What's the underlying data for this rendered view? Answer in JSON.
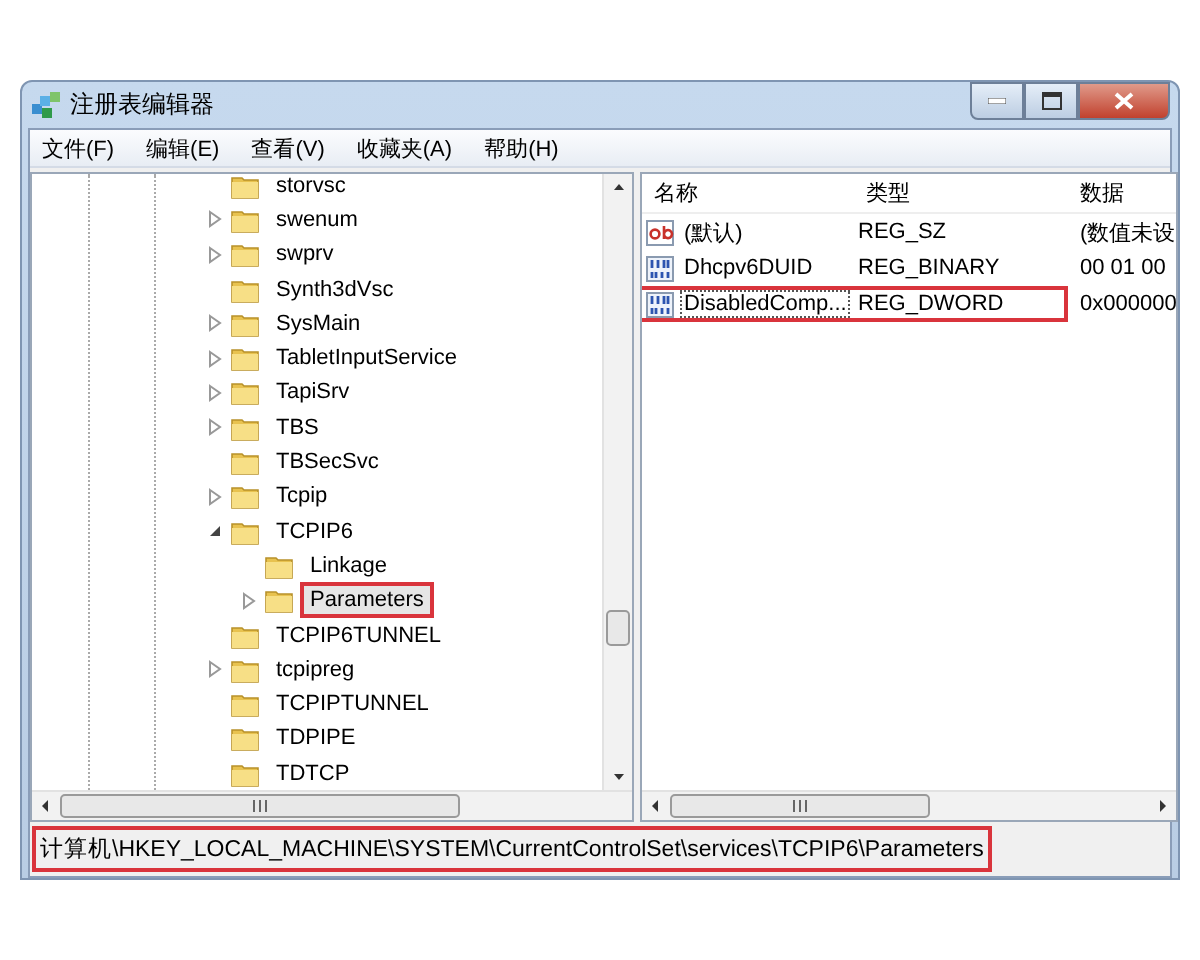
{
  "window": {
    "title": "注册表编辑器"
  },
  "menu": [
    "文件(F)",
    "编辑(E)",
    "查看(V)",
    "收藏夹(A)",
    "帮助(H)"
  ],
  "tree": [
    {
      "label": "storvsc",
      "expandable": false,
      "expanded": false,
      "selected": false,
      "highlighted": false
    },
    {
      "label": "swenum",
      "expandable": true,
      "expanded": false,
      "selected": false,
      "highlighted": false
    },
    {
      "label": "swprv",
      "expandable": true,
      "expanded": false,
      "selected": false,
      "highlighted": false
    },
    {
      "label": "Synth3dVsc",
      "expandable": false,
      "expanded": false,
      "selected": false,
      "highlighted": false
    },
    {
      "label": "SysMain",
      "expandable": true,
      "expanded": false,
      "selected": false,
      "highlighted": false
    },
    {
      "label": "TabletInputService",
      "expandable": true,
      "expanded": false,
      "selected": false,
      "highlighted": false
    },
    {
      "label": "TapiSrv",
      "expandable": true,
      "expanded": false,
      "selected": false,
      "highlighted": false
    },
    {
      "label": "TBS",
      "expandable": true,
      "expanded": false,
      "selected": false,
      "highlighted": false
    },
    {
      "label": "TBSecSvc",
      "expandable": false,
      "expanded": false,
      "selected": false,
      "highlighted": false
    },
    {
      "label": "Tcpip",
      "expandable": true,
      "expanded": false,
      "selected": false,
      "highlighted": false
    },
    {
      "label": "TCPIP6",
      "expandable": true,
      "expanded": true,
      "selected": false,
      "highlighted": false,
      "children": [
        {
          "label": "Linkage",
          "expandable": false,
          "expanded": false,
          "selected": false,
          "highlighted": false
        },
        {
          "label": "Parameters",
          "expandable": true,
          "expanded": false,
          "selected": true,
          "highlighted": true
        }
      ]
    },
    {
      "label": "TCPIP6TUNNEL",
      "expandable": false,
      "expanded": false,
      "selected": false,
      "highlighted": false
    },
    {
      "label": "tcpipreg",
      "expandable": true,
      "expanded": false,
      "selected": false,
      "highlighted": false
    },
    {
      "label": "TCPIPTUNNEL",
      "expandable": false,
      "expanded": false,
      "selected": false,
      "highlighted": false
    },
    {
      "label": "TDPIPE",
      "expandable": false,
      "expanded": false,
      "selected": false,
      "highlighted": false
    },
    {
      "label": "TDTCP",
      "expandable": false,
      "expanded": false,
      "selected": false,
      "highlighted": false
    }
  ],
  "list": {
    "columns": [
      "名称",
      "类型",
      "数据"
    ],
    "rows": [
      {
        "kind": "string",
        "name": "(默认)",
        "type": "REG_SZ",
        "data": "(数值未设",
        "selected": false,
        "highlighted": false
      },
      {
        "kind": "binary",
        "name": "Dhcpv6DUID",
        "type": "REG_BINARY",
        "data": "00 01 00",
        "selected": false,
        "highlighted": false
      },
      {
        "kind": "binary",
        "name": "DisabledComp...",
        "type": "REG_DWORD",
        "data": "0x000000",
        "selected": true,
        "highlighted": true
      }
    ]
  },
  "status_bar": {
    "path": "计算机\\HKEY_LOCAL_MACHINE\\SYSTEM\\CurrentControlSet\\services\\TCPIP6\\Parameters",
    "highlighted": true
  }
}
